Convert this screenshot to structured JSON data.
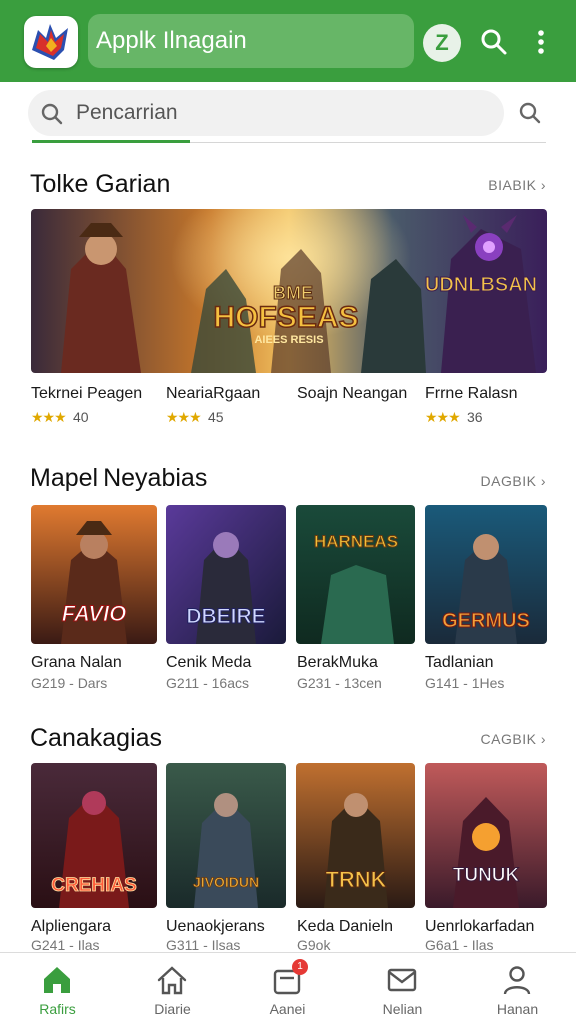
{
  "header": {
    "title": "Applk Ilnagain",
    "badge_letter": "Z",
    "brand_color": "#3a9e3e"
  },
  "search": {
    "placeholder": "Pencarrian"
  },
  "section1": {
    "title": "Tolke Garian",
    "see_all": "BIABIK",
    "banner_text_center_top": "BME",
    "banner_text_center": "HOFSEAS",
    "banner_text_center_sub": "AIEES RESIS",
    "banner_text_right": "UDNLBSAN",
    "items": [
      {
        "name": "Tekrnei Peagen",
        "rating": "40"
      },
      {
        "name": "NeariaRgaan",
        "rating": "45"
      },
      {
        "name": "Soajn Neangan",
        "rating": ""
      },
      {
        "name": "Frrne Ralasn",
        "rating": "36"
      }
    ]
  },
  "section2": {
    "title": "Mapel Neyabias",
    "see_all": "DAGBIK",
    "items": [
      {
        "name": "Grana Nalan",
        "meta": "G219 - Dars",
        "art": "FAVIO"
      },
      {
        "name": "Cenik Meda",
        "meta": "G211 - 16acs",
        "art": "DBEIRE"
      },
      {
        "name": "BerakMuka",
        "meta": "G231 - 13cen",
        "art": "HARNEAS"
      },
      {
        "name": "Tadlanian",
        "meta": "G141 - 1Hes",
        "art": "GERMUS"
      }
    ]
  },
  "section3": {
    "title": "Canakagias",
    "see_all": "CAGBIK",
    "items": [
      {
        "name": "Alpliengara",
        "meta": "G241 - Ilas",
        "art": "CREHIAS"
      },
      {
        "name": "Uenaokjerans",
        "meta": "G311 - Ilsas",
        "art": "JIVOIDUN"
      },
      {
        "name": "Keda Danieln",
        "meta": "G9ok",
        "art": "TRNK"
      },
      {
        "name": "Uenrlokarfadan",
        "meta": "G6a1 - Ilas",
        "art": "TUNUK"
      }
    ]
  },
  "bottom_nav": {
    "items": [
      {
        "label": "Rafirs"
      },
      {
        "label": "Diarie"
      },
      {
        "label": "Aanei"
      },
      {
        "label": "Nelian"
      },
      {
        "label": "Hanan"
      }
    ],
    "notification_count": "1"
  }
}
